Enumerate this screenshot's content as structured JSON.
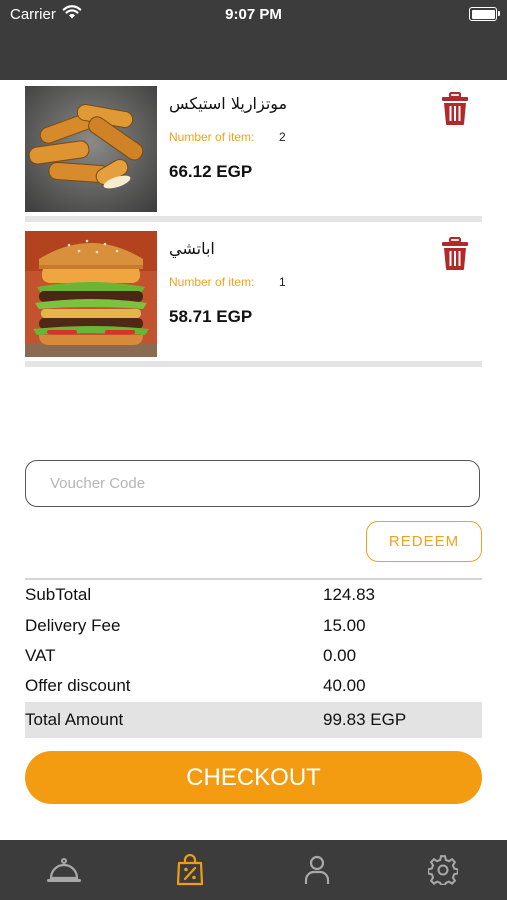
{
  "status_bar": {
    "carrier": "Carrier",
    "time": "9:07 PM"
  },
  "cart": {
    "items": [
      {
        "name": "موتزاريلا استيكس",
        "qty_label": "Number of item:",
        "qty": "2",
        "price": "66.12 EGP",
        "image": "mozzarella-sticks-photo"
      },
      {
        "name": "اباتشي",
        "qty_label": "Number of item:",
        "qty": "1",
        "price": "58.71 EGP",
        "image": "burger-photo"
      }
    ]
  },
  "voucher": {
    "placeholder": "Voucher Code",
    "value": "",
    "redeem_label": "REDEEM"
  },
  "summary": {
    "rows": [
      {
        "label": "SubTotal",
        "value": "124.83"
      },
      {
        "label": "Delivery Fee",
        "value": "15.00"
      },
      {
        "label": "VAT",
        "value": "0.00"
      },
      {
        "label": "Offer discount",
        "value": "40.00"
      }
    ],
    "total": {
      "label": "Total Amount",
      "value": "99.83 EGP"
    }
  },
  "checkout_label": "CHECKOUT",
  "tab_bar": {
    "items": [
      {
        "icon": "cloche-icon",
        "active": false
      },
      {
        "icon": "shopping-bag-discount-icon",
        "active": true
      },
      {
        "icon": "user-icon",
        "active": false
      },
      {
        "icon": "gear-icon",
        "active": false
      }
    ]
  },
  "colors": {
    "accent": "#f39c12",
    "label_orange": "#f0a21c",
    "trash_red": "#b02a2a",
    "bar_bg": "#3c3c3c"
  }
}
